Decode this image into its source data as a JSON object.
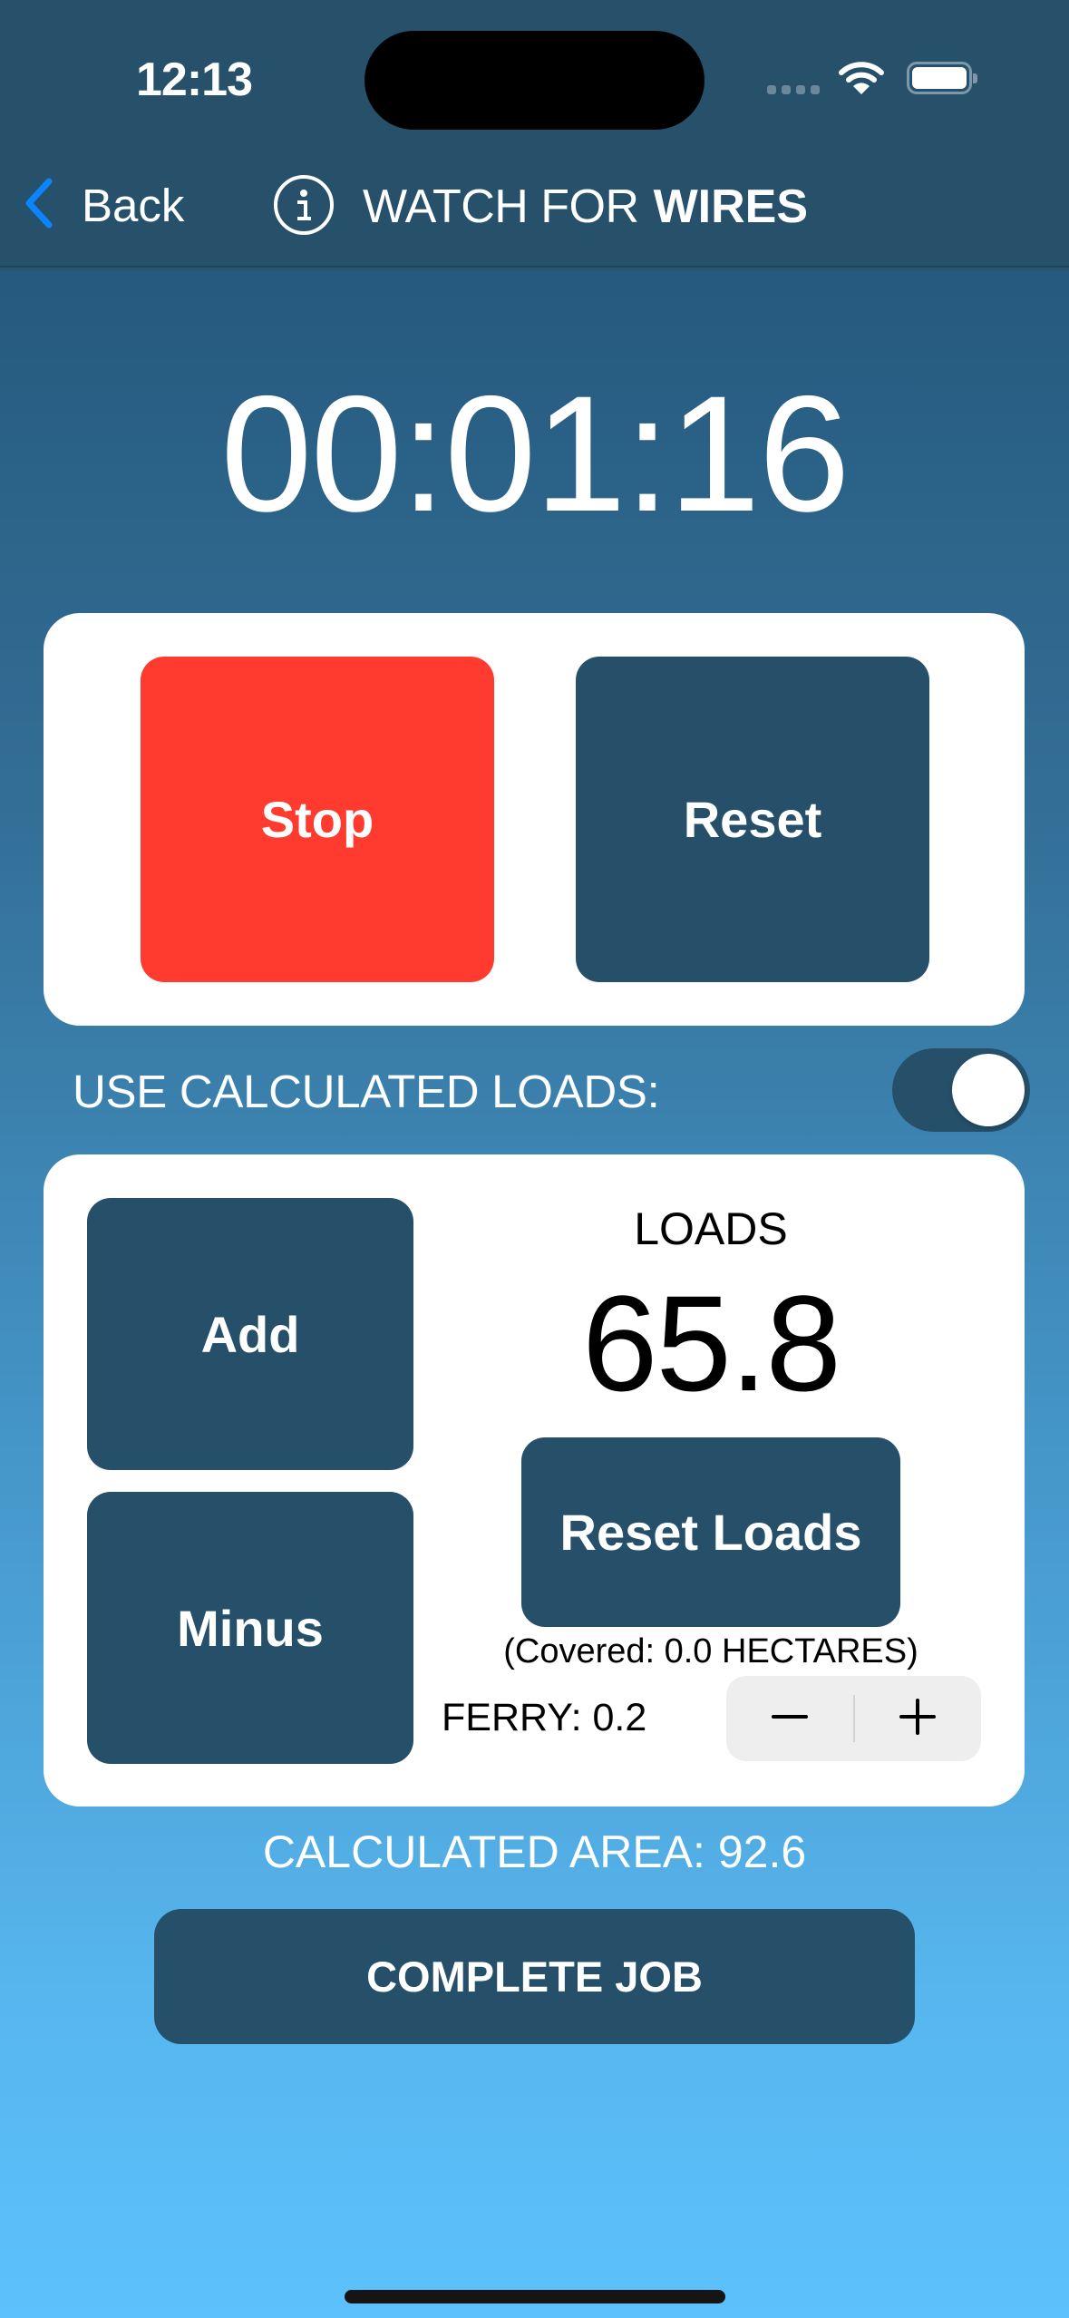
{
  "status_bar": {
    "time": "12:13",
    "signal_icon": "cellular-signal-icon",
    "wifi_icon": "wifi-icon",
    "battery_icon": "battery-icon"
  },
  "nav": {
    "back_label": "Back",
    "back_icon": "chevron-left-icon",
    "info_icon": "info-circle-icon",
    "title_prefix": "WATCH FOR",
    "title_emphasis": "WIRES"
  },
  "timer": {
    "display": "00:01:16"
  },
  "timer_controls": {
    "stop_label": "Stop",
    "reset_label": "Reset"
  },
  "calculated_loads_toggle": {
    "label": "USE CALCULATED LOADS:",
    "enabled": true
  },
  "loads": {
    "add_label": "Add",
    "minus_label": "Minus",
    "heading": "LOADS",
    "value": "65.8",
    "reset_label": "Reset Loads",
    "covered_text": "(Covered: 0.0 HECTARES)",
    "ferry_text": "FERRY: 0.2",
    "stepper_decrement": "minus-icon",
    "stepper_increment": "plus-icon"
  },
  "calculated_area": "CALCULATED AREA: 92.6",
  "complete_job_label": "COMPLETE JOB",
  "colors": {
    "header_bg": "#27506a",
    "primary_button": "#264f69",
    "stop_button": "#ff3b30",
    "back_accent": "#0a84ff",
    "gradient_top": "#265a7e",
    "gradient_bottom": "#5cc1fc"
  }
}
